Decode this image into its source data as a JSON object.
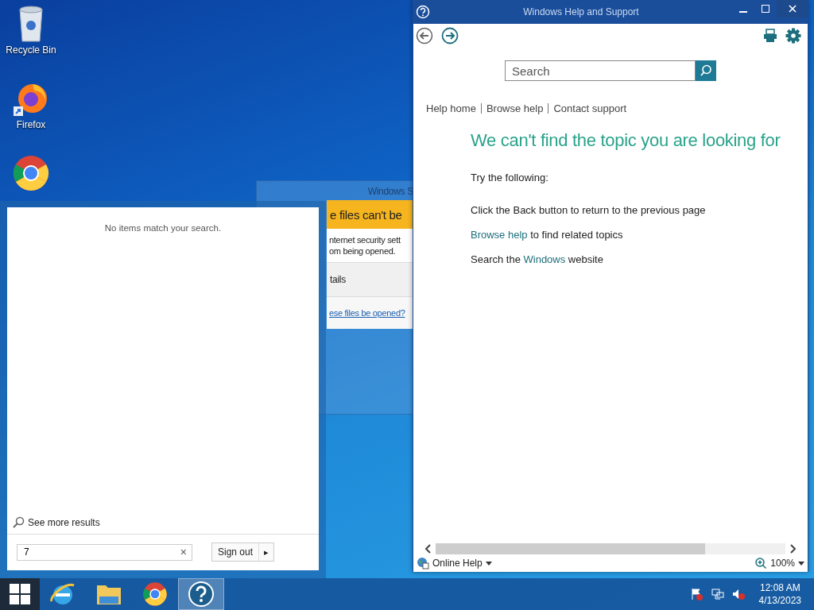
{
  "desktop_icons": [
    {
      "kind": "recycle",
      "label": "Recycle Bin"
    },
    {
      "kind": "firefox",
      "label": "Firefox"
    },
    {
      "kind": "chrome"
    }
  ],
  "background_window": {
    "title": "Windows S",
    "banner": "e files can't be",
    "message_lines": [
      "nternet security sett",
      "om being opened."
    ],
    "details": "tails",
    "link": "ese files be opened?"
  },
  "start_search": {
    "empty_message": "No items match your search.",
    "more_results": "See more results",
    "query": "7",
    "clear": "×",
    "sign_out": "Sign out",
    "sign_out_arrow": "▸"
  },
  "help_window": {
    "title": "Windows Help and Support",
    "search": {
      "placeholder": "Search"
    },
    "nav_links": [
      {
        "text": "Help home"
      },
      {
        "text": "Browse help"
      },
      {
        "text": "Contact support"
      }
    ],
    "heading": "We can't find the topic you are looking for",
    "intro": "Try the following:",
    "suggestions": [
      {
        "parts": [
          {
            "text": "Click the Back button to return to the previous page",
            "link": false
          }
        ]
      },
      {
        "parts": [
          {
            "text": "Browse help",
            "link": true
          },
          {
            "text": " to find related topics",
            "link": false
          }
        ]
      },
      {
        "parts": [
          {
            "text": "Search the ",
            "link": false
          },
          {
            "text": "Windows",
            "link": true
          },
          {
            "text": " website",
            "link": false
          }
        ]
      }
    ],
    "status": {
      "mode": "Online Help",
      "zoom": "100%"
    }
  },
  "taskbar": {
    "apps": [
      {
        "kind": "ie",
        "selected": false
      },
      {
        "kind": "explorer",
        "selected": false
      },
      {
        "kind": "chrome",
        "selected": false
      },
      {
        "kind": "help",
        "selected": true
      }
    ],
    "tray": {
      "time": "12:08 AM",
      "date": "4/13/2023"
    }
  }
}
